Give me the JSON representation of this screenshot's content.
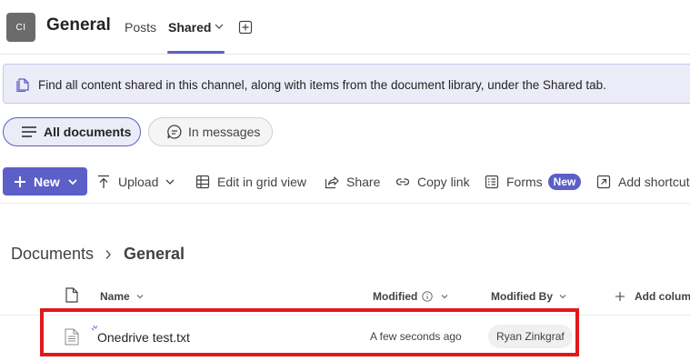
{
  "header": {
    "avatar_initials": "CI",
    "channel_title": "General",
    "tabs": [
      {
        "label": "Posts"
      },
      {
        "label": "Shared"
      }
    ]
  },
  "banner": {
    "text": "Find all content shared in this channel, along with items from the document library, under the Shared tab."
  },
  "filters": [
    {
      "label": "All documents",
      "icon": "list-icon",
      "active": true
    },
    {
      "label": "In messages",
      "icon": "chat-icon",
      "active": false
    }
  ],
  "toolbar": {
    "new_label": "New",
    "upload_label": "Upload",
    "grid_label": "Edit in grid view",
    "share_label": "Share",
    "copy_label": "Copy link",
    "forms_label": "Forms",
    "forms_badge": "New",
    "shortcut_label": "Add shortcut"
  },
  "breadcrumb": {
    "root": "Documents",
    "current": "General"
  },
  "columns": {
    "name": "Name",
    "modified": "Modified",
    "modified_by": "Modified By",
    "add_column": "Add column"
  },
  "files": [
    {
      "name": "Onedrive test.txt",
      "modified": "A few seconds ago",
      "modified_by": "Ryan Zinkgraf"
    }
  ],
  "colors": {
    "accent": "#5b5fc7",
    "banner_bg": "#ebecf7",
    "highlight": "#e0191b"
  }
}
